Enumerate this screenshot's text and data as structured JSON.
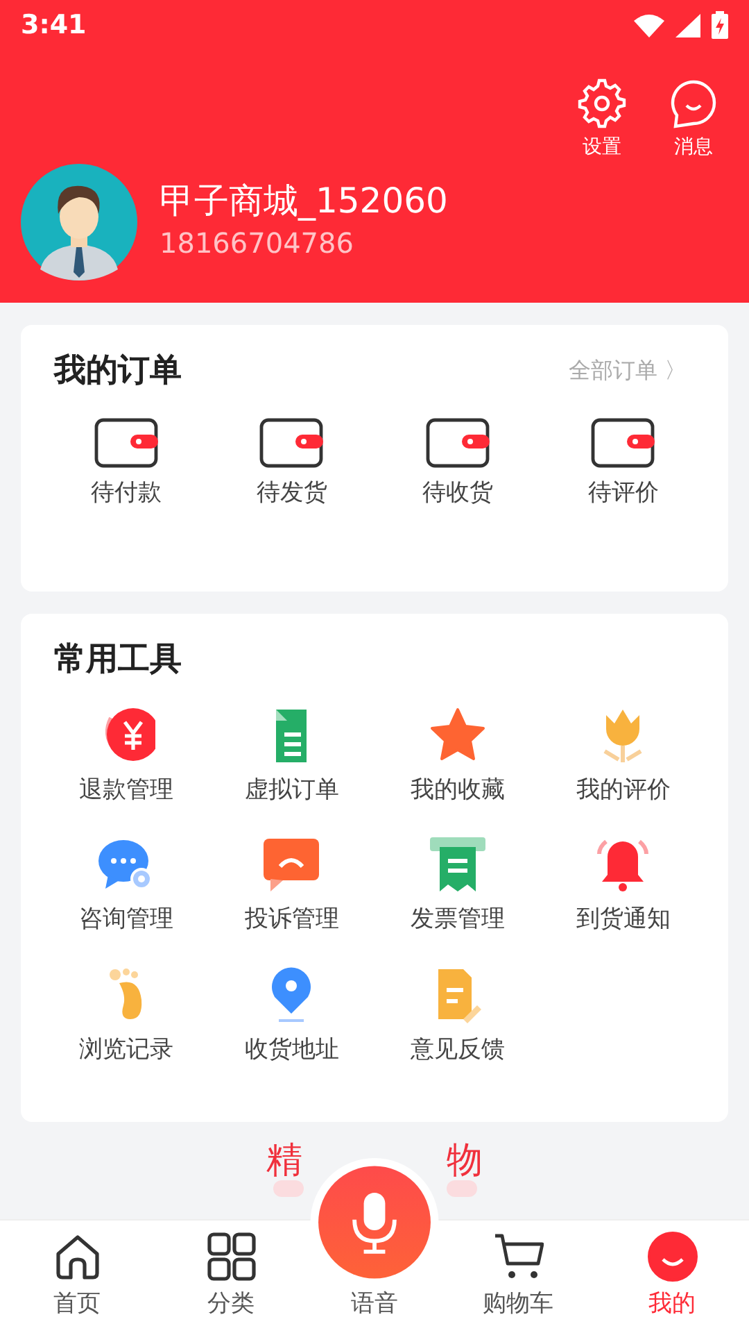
{
  "status_bar": {
    "time": "3:41"
  },
  "header": {
    "actions": [
      {
        "kind": "settings",
        "label": "设置"
      },
      {
        "kind": "message",
        "label": "消息"
      }
    ],
    "username": "甲子商城_152060",
    "phone": "18166704786"
  },
  "orders": {
    "title": "我的订单",
    "more": "全部订单",
    "more_arrow": "〉",
    "items": [
      {
        "label": "待付款"
      },
      {
        "label": "待发货"
      },
      {
        "label": "待收货"
      },
      {
        "label": "待评价"
      }
    ]
  },
  "tools": {
    "title": "常用工具",
    "items": [
      {
        "kind": "refund",
        "label": "退款管理"
      },
      {
        "kind": "virtual",
        "label": "虚拟订单"
      },
      {
        "kind": "favorite",
        "label": "我的收藏"
      },
      {
        "kind": "review",
        "label": "我的评价"
      },
      {
        "kind": "consult",
        "label": "咨询管理"
      },
      {
        "kind": "complaint",
        "label": "投诉管理"
      },
      {
        "kind": "invoice",
        "label": "发票管理"
      },
      {
        "kind": "notify",
        "label": "到货通知"
      },
      {
        "kind": "history",
        "label": "浏览记录"
      },
      {
        "kind": "address",
        "label": "收货地址"
      },
      {
        "kind": "feedback",
        "label": "意见反馈"
      }
    ]
  },
  "section_title": {
    "left": "精",
    "right": "物"
  },
  "tab_bar": [
    {
      "kind": "home",
      "label": "首页",
      "selected": false
    },
    {
      "kind": "category",
      "label": "分类",
      "selected": false
    },
    {
      "kind": "voice",
      "label": "语音",
      "selected": false
    },
    {
      "kind": "cart",
      "label": "购物车",
      "selected": false
    },
    {
      "kind": "me",
      "label": "我的",
      "selected": true
    }
  ]
}
